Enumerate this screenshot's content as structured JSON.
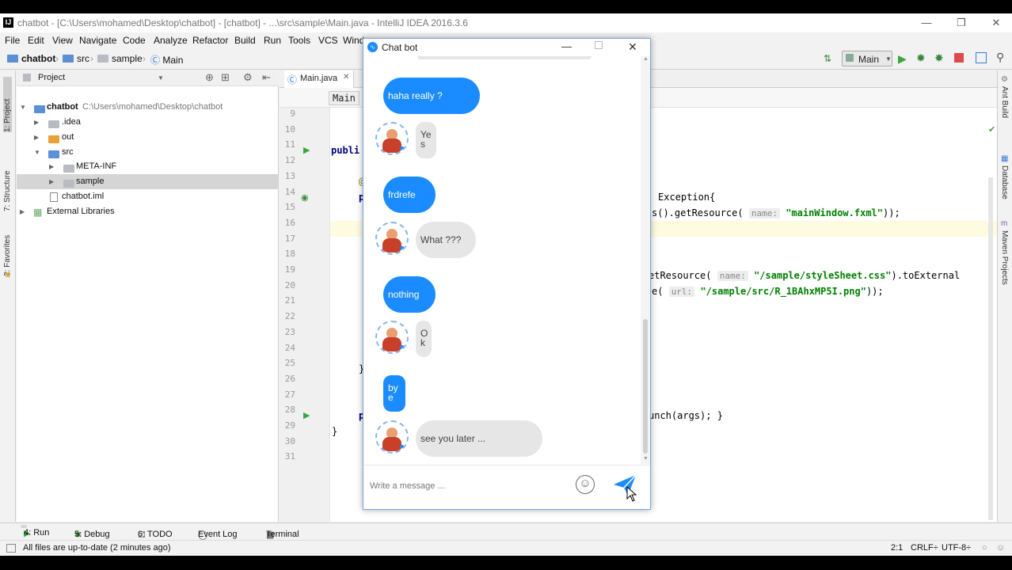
{
  "window": {
    "title": "chatbot - [C:\\Users\\mohamed\\Desktop\\chatbot] - [chatbot] - ...\\src\\sample\\Main.java - IntelliJ IDEA 2016.3.6",
    "app_icon": "IJ"
  },
  "menu": [
    "File",
    "Edit",
    "View",
    "Navigate",
    "Code",
    "Analyze",
    "Refactor",
    "Build",
    "Run",
    "Tools",
    "VCS",
    "Wind"
  ],
  "breadcrumb": [
    "chatbot",
    "src",
    "sample",
    "Main"
  ],
  "run_config": "Main",
  "project_panel": {
    "title": "Project",
    "tree": [
      {
        "label": "chatbot",
        "path": "C:\\Users\\mohamed\\Desktop\\chatbot",
        "level": 0,
        "icon": "folder-blue"
      },
      {
        "label": ".idea",
        "level": 1,
        "icon": "folder"
      },
      {
        "label": "out",
        "level": 1,
        "icon": "folder-orange"
      },
      {
        "label": "src",
        "level": 1,
        "icon": "folder-blue"
      },
      {
        "label": "META-INF",
        "level": 2,
        "icon": "folder"
      },
      {
        "label": "sample",
        "level": 2,
        "icon": "folder"
      },
      {
        "label": "chatbot.iml",
        "level": 1,
        "icon": "file"
      },
      {
        "label": "External Libraries",
        "level": 0,
        "icon": "library"
      }
    ]
  },
  "left_tool_tabs": [
    "1: Project",
    "7: Structure",
    "2: Favorites"
  ],
  "right_tool_tabs": [
    "Ant Build",
    "Database",
    "Maven Projects"
  ],
  "editor": {
    "tab": "Main.java",
    "crumb": "Main",
    "line_numbers": [
      "9",
      "10",
      "11",
      "12",
      "13",
      "14",
      "15",
      "16",
      "17",
      "18",
      "19",
      "20",
      "21",
      "22",
      "23",
      "24",
      "25",
      "26",
      "27",
      "28",
      "29",
      "30",
      "31"
    ],
    "fragments": {
      "l10": "publi",
      "l13_tail": "Exception{",
      "l14_a": "s().getResource(",
      "l14_hint": "name:",
      "l14_str": "\"mainWindow.fxml\"",
      "l14_end": "));",
      "l18_a": "etResource(",
      "l18_hint": "name:",
      "l18_str": "\"/sample/styleSheet.css\"",
      "l18_end": ").toExternal",
      "l19_a": "e(",
      "l19_hint": "url:",
      "l19_str": "\"/sample/src/R_1BAhxMP5I.png\"",
      "l19_end": "));",
      "l27": "unch(args); }",
      "l30": "}",
      "l12": "@",
      "l13": "p",
      "l24": "}",
      "l27_p": "p"
    }
  },
  "bottom_tabs": [
    "4: Run",
    "5: Debug",
    "6: TODO",
    "Event Log",
    "Terminal"
  ],
  "status": {
    "message": "All files are up-to-date (2 minutes ago)",
    "position": "2:1",
    "line_sep": "CRLF÷",
    "encoding": "UTF-8÷"
  },
  "chat": {
    "title": "Chat bot",
    "messages": [
      {
        "from": "me",
        "text": "haha really ?"
      },
      {
        "from": "bot",
        "lines": [
          "Ye",
          "s"
        ]
      },
      {
        "from": "me",
        "text": "frdrefe"
      },
      {
        "from": "bot",
        "lines": [
          "What ???"
        ]
      },
      {
        "from": "me",
        "text": "nothing"
      },
      {
        "from": "bot",
        "lines": [
          "O",
          "k"
        ]
      },
      {
        "from": "me",
        "lines": [
          "by",
          "e"
        ]
      },
      {
        "from": "bot",
        "lines": [
          "see you later ..."
        ]
      }
    ],
    "placeholder": "Write a message ...",
    "colors": {
      "user_bubble": "#1a8cff",
      "bot_bubble": "#e6e6e6",
      "send": "#1a8cff"
    }
  }
}
